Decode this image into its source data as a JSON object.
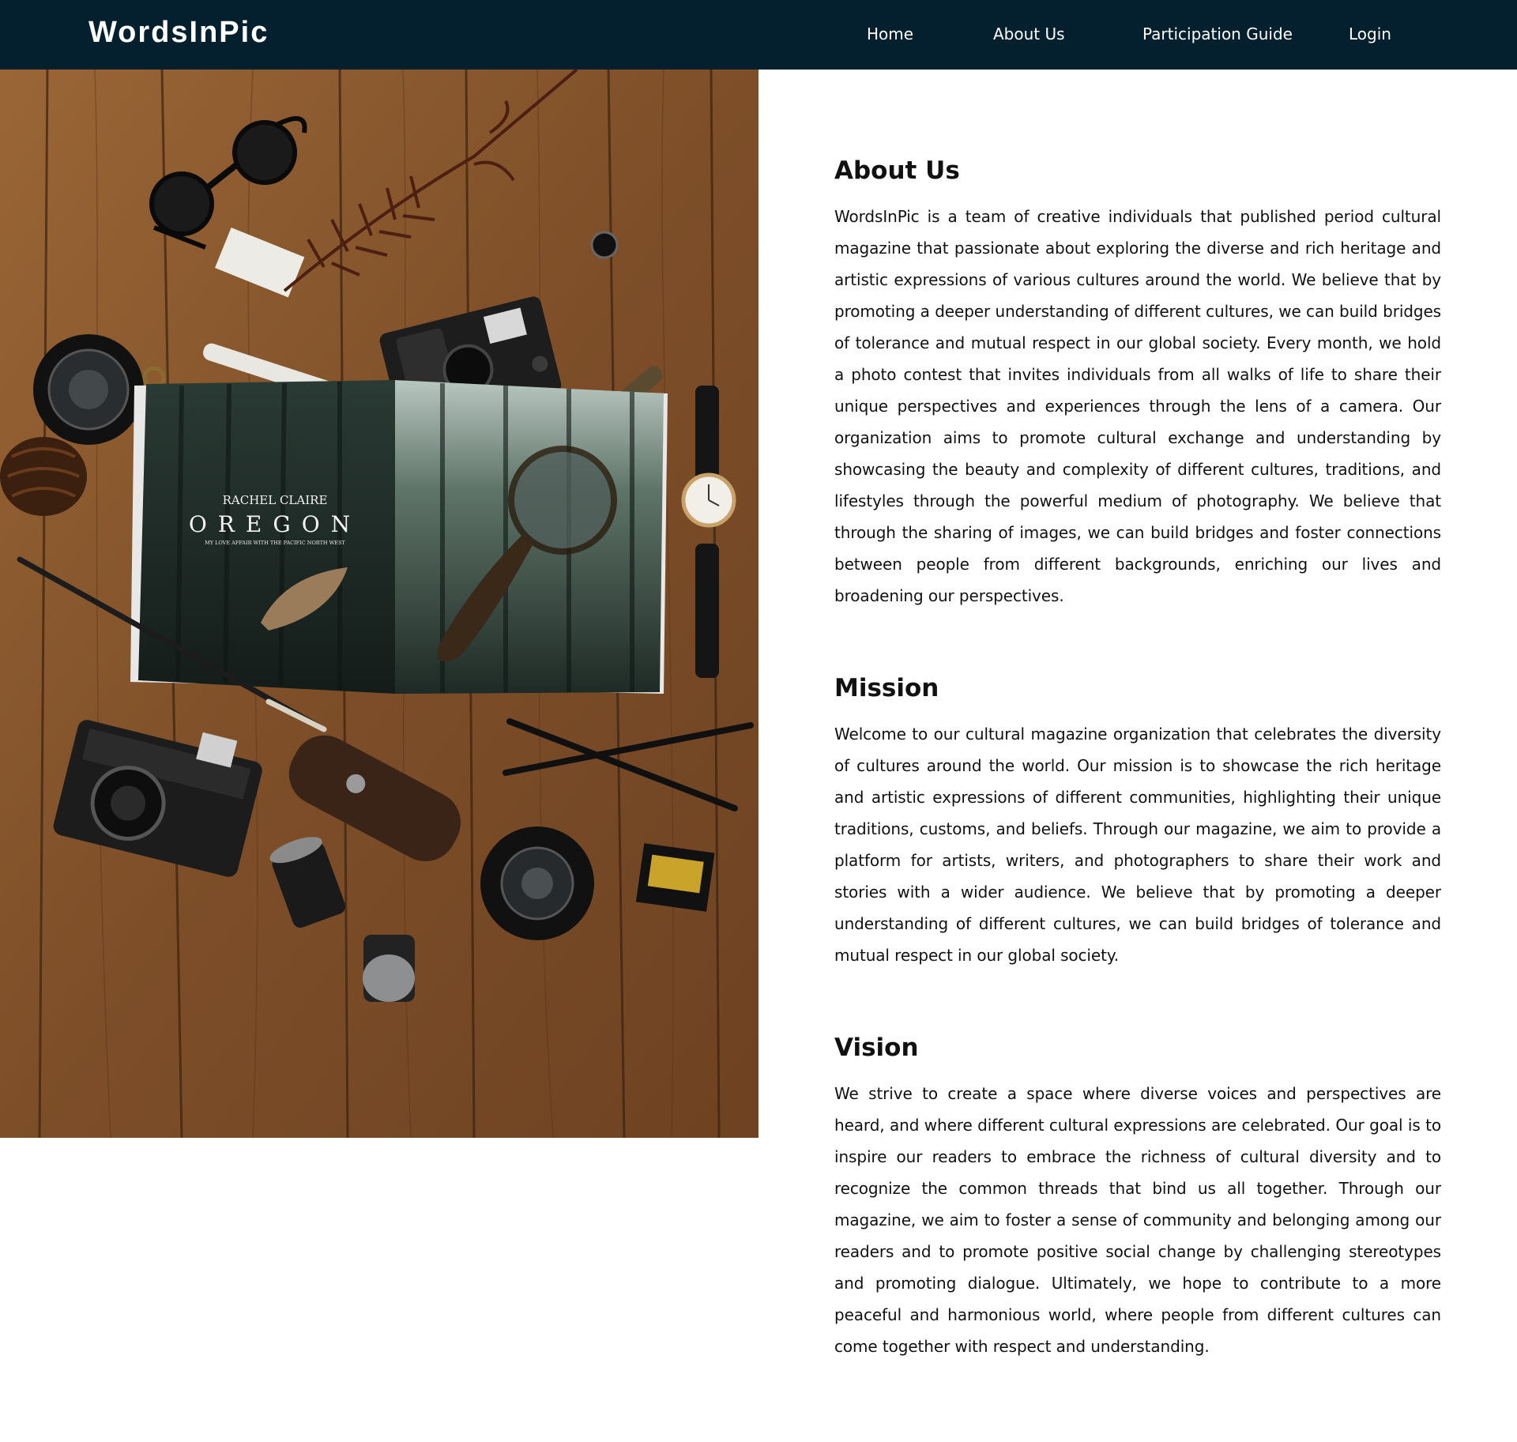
{
  "brand": {
    "name": "WordsInPic"
  },
  "nav": {
    "items": [
      {
        "label": "Home"
      },
      {
        "label": "About Us"
      },
      {
        "label": "Participation Guide"
      },
      {
        "label": "Login"
      }
    ]
  },
  "hero_image": {
    "magazine_author": "RACHEL CLAIRE",
    "magazine_title": "OREGON",
    "magazine_subtitle": "MY LOVE AFFAIR WITH THE PACIFIC NORTH WEST"
  },
  "sections": {
    "about": {
      "title": "About Us",
      "text": "WordsInPic is a team of creative individuals that published period cultural magazine that passionate about exploring the diverse and rich heritage and artistic expressions of various cultures around the world. We believe that by promoting a deeper understanding of different cultures, we can build bridges of tolerance and mutual respect in our global society. Every month, we hold a photo contest that invites individuals from all walks of life to share their unique perspectives and experiences through the lens of a camera. Our organization aims to promote cultural exchange and understanding by showcasing the beauty and complexity of different cultures, traditions, and lifestyles through the powerful medium of photography. We believe that through the sharing of images, we can build bridges and foster connections between people from different backgrounds, enriching our lives and broadening our perspectives."
    },
    "mission": {
      "title": "Mission",
      "text": "Welcome to our cultural magazine organization that celebrates the diversity of cultures around the world. Our mission is to showcase the rich heritage and artistic expressions of different communities, highlighting their unique traditions, customs, and beliefs. Through our magazine, we aim to provide a platform for artists, writers, and photographers to share their work and stories with a wider audience. We believe that by promoting a deeper understanding of different cultures, we can build bridges of tolerance and mutual respect in our global society."
    },
    "vision": {
      "title": "Vision",
      "text": "We strive to create a space where diverse voices and perspectives are heard, and where different cultural expressions are celebrated. Our goal is to inspire our readers to embrace the richness of cultural diversity and to recognize the common threads that bind us all together. Through our magazine, we aim to foster a sense of community and belonging among our readers and to promote positive social change by challenging stereotypes and promoting dialogue. Ultimately, we hope to contribute to a more peaceful and harmonious world, where people from different cultures can come together with respect and understanding."
    }
  }
}
